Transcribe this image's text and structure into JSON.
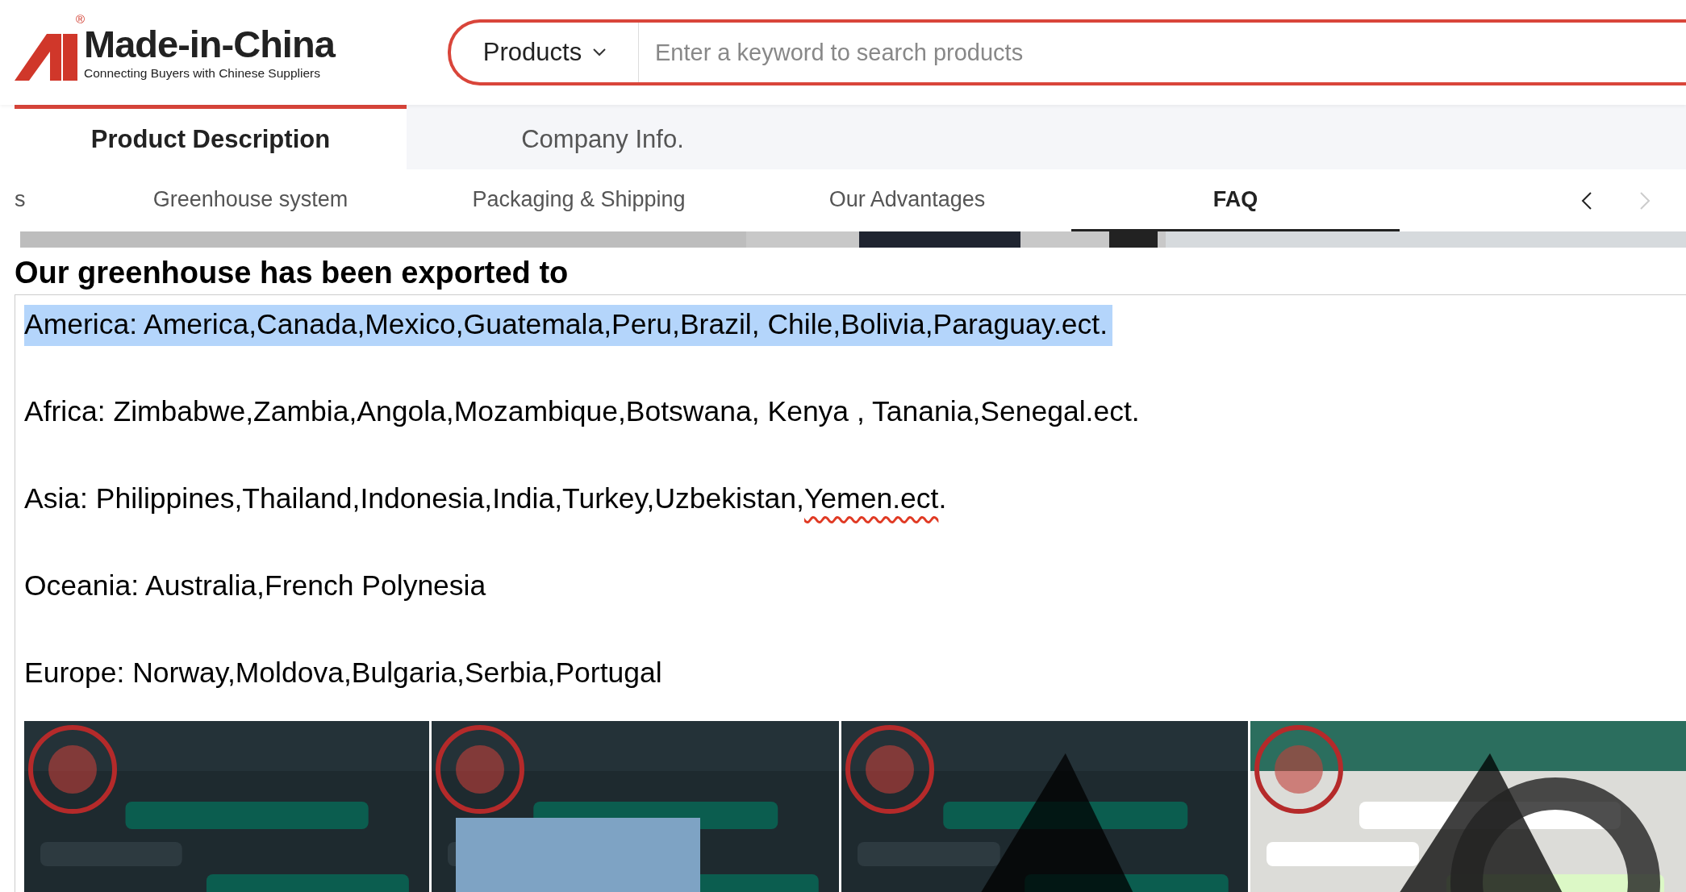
{
  "header": {
    "brand": "Made-in-China",
    "registered": "®",
    "tagline": "Connecting Buyers with Chinese Suppliers",
    "search": {
      "category": "Products",
      "placeholder": "Enter a keyword to search products"
    }
  },
  "main_tabs": [
    {
      "label": "Product Description",
      "selected": true
    },
    {
      "label": "Company Info.",
      "selected": false
    }
  ],
  "section_nav": {
    "items": [
      {
        "label": "s",
        "selected": false
      },
      {
        "label": "Greenhouse system",
        "selected": false
      },
      {
        "label": "Packaging & Shipping",
        "selected": false
      },
      {
        "label": "Our Advantages",
        "selected": false
      },
      {
        "label": "FAQ",
        "selected": true
      }
    ],
    "prev_disabled": false,
    "next_disabled": true
  },
  "content": {
    "heading": "Our greenhouse has been exported to",
    "lines": [
      {
        "text": "America: America,Canada,Mexico,Guatemala,Peru,Brazil, Chile,Bolivia,Paraguay.ect.",
        "selected": true
      },
      {
        "text": "Africa: Zimbabwe,Zambia,Angola,Mozambique,Botswana, Kenya , Tanania,Senegal.ect.",
        "selected": false
      },
      {
        "text": "Asia: Philippines,Thailand,Indonesia,India,Turkey,Uzbekistan,",
        "underlined": "Yemen.ect",
        "after": ".",
        "selected": false
      },
      {
        "text": "Oceania: Australia,French Polynesia",
        "selected": false
      },
      {
        "text": "Europe: Norway,Moldova,Bulgaria,Serbia,Portugal",
        "selected": false
      }
    ]
  }
}
